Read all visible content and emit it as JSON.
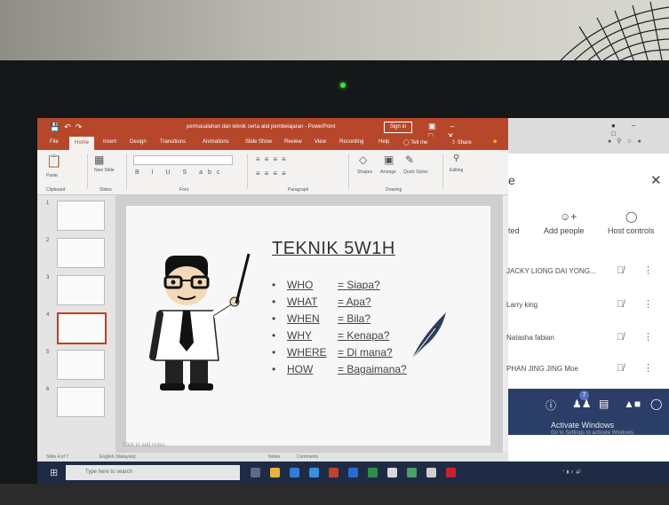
{
  "window": {
    "title": "permasalahan dan teknik serta alat pembelajaran - PowerPoint",
    "sign_in": "Sign in"
  },
  "ribbon": {
    "tabs": [
      "File",
      "Home",
      "Insert",
      "Design",
      "Transitions",
      "Animations",
      "Slide Show",
      "Review",
      "View",
      "Recording",
      "Help",
      "Tell me",
      "Share"
    ],
    "buttons": {
      "paste": "Paste",
      "new_slide": "New Slide",
      "shapes": "Shapes",
      "arrange": "Arrange",
      "quick_styles": "Quick Styles",
      "editing": "Editing"
    },
    "groups": {
      "clipboard": "Clipboard",
      "slides": "Slides",
      "font": "Font",
      "paragraph": "Paragraph",
      "drawing": "Drawing"
    }
  },
  "thumbnails": {
    "numbers": [
      "1",
      "2",
      "3",
      "4",
      "5",
      "6"
    ],
    "selected": "4"
  },
  "slide": {
    "title": "TEKNIK 5W1H",
    "rows": [
      {
        "k": "WHO",
        "v": "= Siapa?"
      },
      {
        "k": "WHAT",
        "v": "= Apa?"
      },
      {
        "k": "WHEN",
        "v": "= Bila?"
      },
      {
        "k": "WHY",
        "v": "= Kenapa?"
      },
      {
        "k": "WHERE",
        "v": "= Di mana?"
      },
      {
        "k": "HOW",
        "v": "= Bagaimana?"
      }
    ]
  },
  "notes_placeholder": "Click to add notes",
  "status": {
    "slide": "Slide 4 of 7",
    "language": "English (Malaysia)",
    "notes": "Notes",
    "comments": "Comments"
  },
  "taskbar": {
    "search_placeholder": "Type here to search"
  },
  "panel": {
    "title": "e",
    "actions": {
      "invited": "ted",
      "add_people": "Add people",
      "host_controls": "Host controls"
    },
    "participants": [
      "JACKY LIONG DAI YONG...",
      "Larry king",
      "Natasha fabian",
      "PHAN JING JING Moe"
    ],
    "participant_count": "7",
    "activate": "Activate Windows",
    "activate_sub": "Go to Settings to activate Windows."
  }
}
